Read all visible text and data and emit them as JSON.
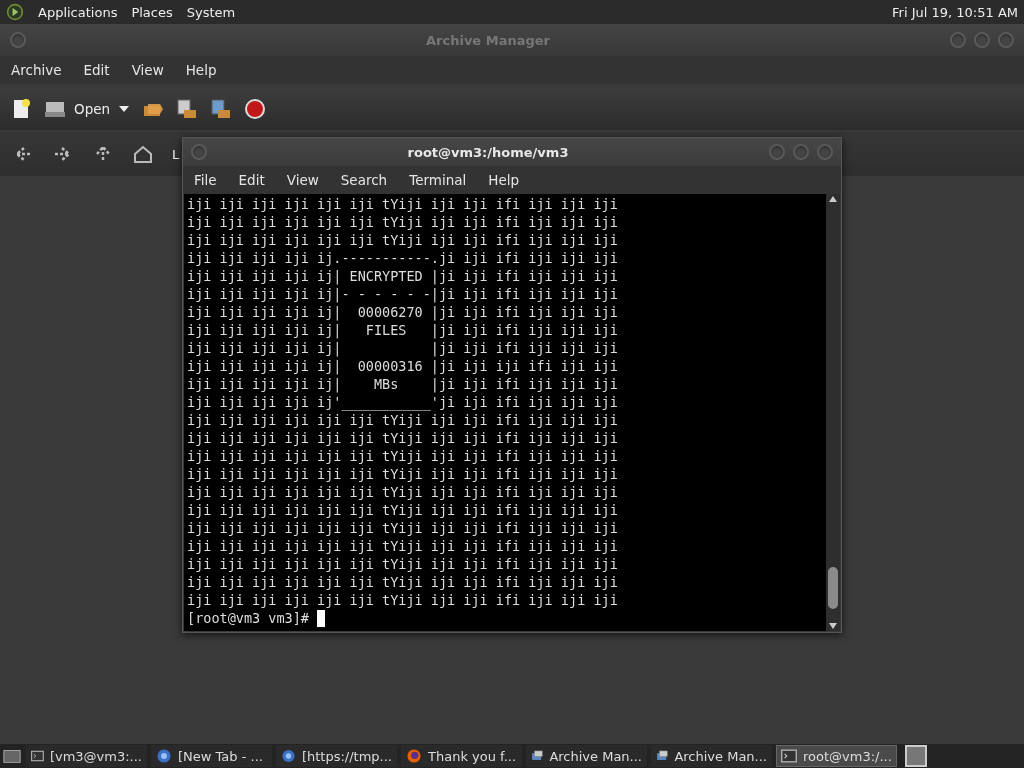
{
  "top_panel": {
    "menus": [
      "Applications",
      "Places",
      "System"
    ],
    "clock": "Fri Jul 19, 10:51 AM"
  },
  "archive_window": {
    "title": "Archive Manager",
    "menu": [
      "Archive",
      "Edit",
      "View",
      "Help"
    ],
    "open_label": "Open",
    "location_label": "L"
  },
  "terminal": {
    "title": "root@vm3:/home/vm3",
    "menu": [
      "File",
      "Edit",
      "View",
      "Search",
      "Terminal",
      "Help"
    ],
    "lines": [
      "iji iji iji iji iji iji tYiji iji iji ifi iji iji iji",
      "iji iji iji iji iji iji tYiji iji iji ifi iji iji iji",
      "iji iji iji iji iji iji tYiji iji iji ifi iji iji iji",
      "iji iji iji iji ij.-----------.ji iji ifi iji iji iji",
      "iji iji iji iji ij| ENCRYPTED |ji iji ifi iji iji iji",
      "iji iji iji iji ij|- - - - - -|ji iji ifi iji iji iji",
      "iji iji iji iji ij|  00006270 |ji iji ifi iji iji iji",
      "iji iji iji iji ij|   FILES   |ji iji ifi iji iji iji",
      "iji iji iji iji ij|           |ji iji ifi iji iji iji",
      "iji iji iji iji ij|  00000316 |ji iji iji ifi iji iji",
      "iji iji iji iji ij|    MBs    |ji iji ifi iji iji iji",
      "iji iji iji iji ij'___________'ji iji ifi iji iji iji",
      "iji iji iji iji iji iji tYiji iji iji ifi iji iji iji",
      "iji iji iji iji iji iji tYiji iji iji ifi iji iji iji",
      "iji iji iji iji iji iji tYiji iji iji ifi iji iji iji",
      "iji iji iji iji iji iji tYiji iji iji ifi iji iji iji",
      "iji iji iji iji iji iji tYiji iji iji ifi iji iji iji",
      "iji iji iji iji iji iji tYiji iji iji ifi iji iji iji",
      "iji iji iji iji iji iji tYiji iji iji ifi iji iji iji",
      "iji iji iji iji iji iji tYiji iji iji ifi iji iji iji",
      "iji iji iji iji iji iji tYiji iji iji ifi iji iji iji",
      "iji iji iji iji iji iji tYiji iji iji ifi iji iji iji",
      "iji iji iji iji iji iji tYiji iji iji ifi iji iji iji"
    ],
    "prompt": "[root@vm3 vm3]#"
  },
  "taskbar": {
    "tasks": [
      {
        "kind": "terminal",
        "label": "[vm3@vm3:...",
        "selected": false
      },
      {
        "kind": "browser",
        "label": "[New Tab - ...",
        "selected": false
      },
      {
        "kind": "browser",
        "label": "[https://tmp...",
        "selected": false
      },
      {
        "kind": "firefox",
        "label": "Thank you f...",
        "selected": false
      },
      {
        "kind": "archive",
        "label": "Archive Man...",
        "selected": false
      },
      {
        "kind": "archive",
        "label": "Archive Man...",
        "selected": false
      },
      {
        "kind": "terminal",
        "label": "root@vm3:/...",
        "selected": true
      }
    ]
  }
}
